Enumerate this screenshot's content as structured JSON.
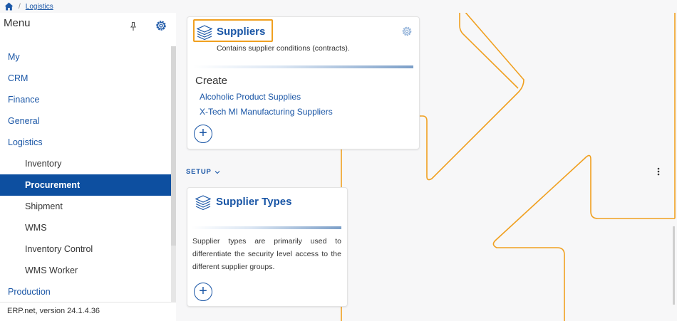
{
  "breadcrumb": {
    "home_icon": "home-icon",
    "separator": "/",
    "current": "Logistics"
  },
  "sidebar": {
    "title": "Menu",
    "pin_icon": "pin-icon",
    "settings_icon": "gear-icon",
    "items": [
      {
        "label": "My",
        "level": 1,
        "active": false
      },
      {
        "label": "CRM",
        "level": 1,
        "active": false
      },
      {
        "label": "Finance",
        "level": 1,
        "active": false
      },
      {
        "label": "General",
        "level": 1,
        "active": false
      },
      {
        "label": "Logistics",
        "level": 1,
        "active": false
      },
      {
        "label": "Inventory",
        "level": 2,
        "active": false
      },
      {
        "label": "Procurement",
        "level": 2,
        "active": true
      },
      {
        "label": "Shipment",
        "level": 2,
        "active": false
      },
      {
        "label": "WMS",
        "level": 2,
        "active": false
      },
      {
        "label": "Inventory Control",
        "level": 2,
        "active": false
      },
      {
        "label": "WMS Worker",
        "level": 2,
        "active": false
      },
      {
        "label": "Production",
        "level": 1,
        "active": false
      }
    ],
    "version": "ERP.net, version 24.1.4.36"
  },
  "suppliers_card": {
    "title": "Suppliers",
    "icon": "stack-icon",
    "description": "Contains supplier conditions (contracts).",
    "create_label": "Create",
    "links": [
      "Alcoholic Product Supplies",
      "X-Tech MI Manufacturing Suppliers"
    ],
    "add_label": "+"
  },
  "setup": {
    "label": "SETUP",
    "icon": "chevron-down-icon"
  },
  "supplier_types_card": {
    "title": "Supplier Types",
    "icon": "stack-icon",
    "description": "Supplier types are primarily used to differentiate the security level access to the different supplier groups.",
    "add_label": "+"
  },
  "more_icon": "kebab-icon",
  "colors": {
    "accent": "#1a56a6",
    "active_bg": "#0d4fa0",
    "highlight": "#f0a020"
  }
}
